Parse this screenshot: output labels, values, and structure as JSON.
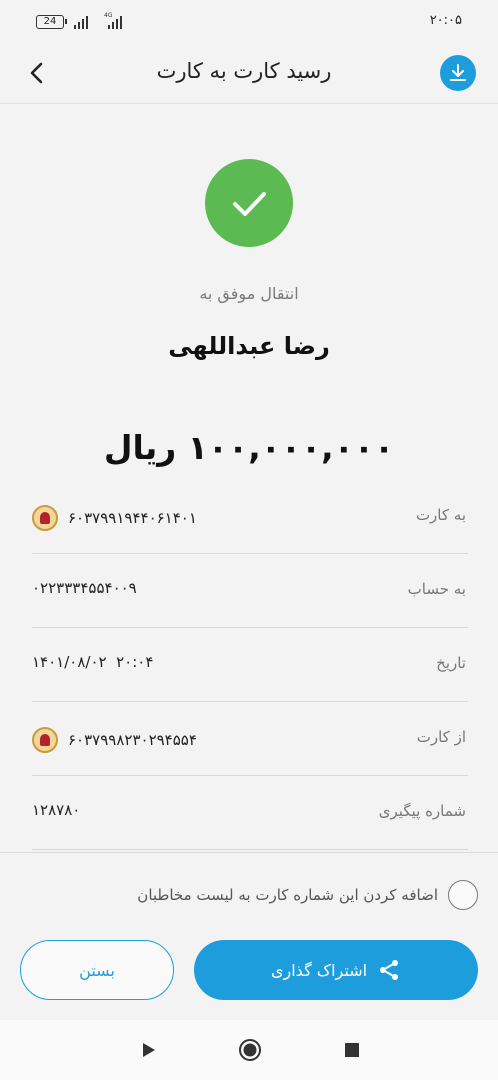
{
  "status_bar": {
    "battery": "24",
    "network": "4G",
    "time": "۲۰:۰۵"
  },
  "header": {
    "title": "رسید کارت به کارت",
    "back_icon": "chevron-left-icon",
    "download_icon": "download-icon"
  },
  "receipt": {
    "status_icon": "check-icon",
    "success_label": "انتقال موفق به",
    "recipient_name": "رضا عبداللهی",
    "amount": "۱۰۰,۰۰۰,۰۰۰ ریال"
  },
  "details": [
    {
      "label": "به کارت",
      "value": "۶۰۳۷۹۹۱۹۴۴۰۶۱۴۰۱",
      "bank_logo": true
    },
    {
      "label": "به حساب",
      "value": "۰۲۲۳۳۳۴۵۵۴۰۰۹",
      "bank_logo": false
    },
    {
      "label": "تاریخ",
      "value": "۱۴۰۱/۰۸/۰۲  ۲۰:۰۴",
      "bank_logo": false
    },
    {
      "label": "از کارت",
      "value": "۶۰۳۷۹۹۸۲۳۰۲۹۴۵۵۴",
      "bank_logo": true
    },
    {
      "label": "شماره پیگیری",
      "value": "۱۲۸۷۸۰",
      "bank_logo": false
    }
  ],
  "contact_option": {
    "label": "اضافه کردن این شماره کارت به لیست مخاطبان",
    "checked": false
  },
  "actions": {
    "close_label": "بستن",
    "share_label": "اشتراک گذاری",
    "share_icon": "share-icon"
  },
  "nav_bar": {
    "back_icon": "play-triangle-icon",
    "home_icon": "home-circle-icon",
    "recents_icon": "square-icon"
  },
  "colors": {
    "accent": "#1e9ddd",
    "success": "#5cba52",
    "background": "#f3f3f3"
  }
}
